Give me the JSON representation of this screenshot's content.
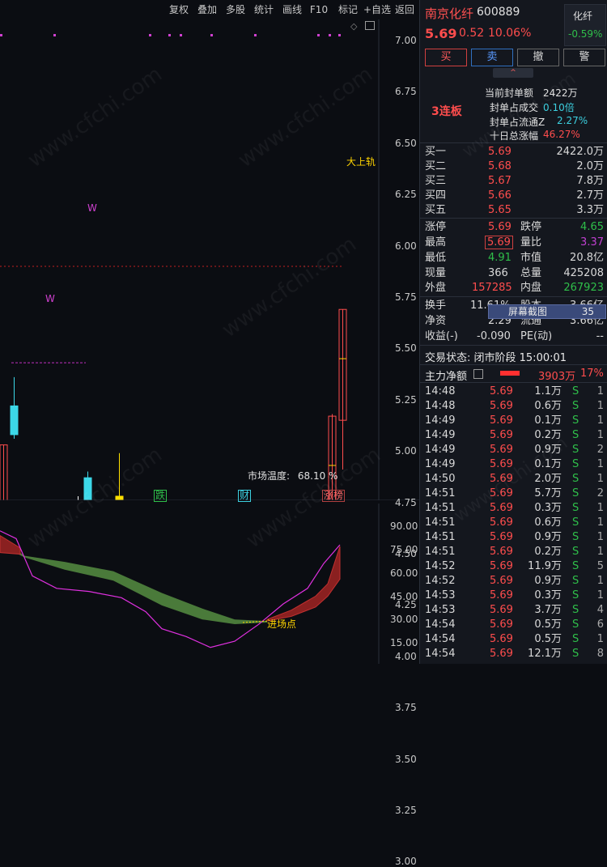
{
  "toolbar": [
    "复权",
    "叠加",
    "多股",
    "统计",
    "画线",
    "F10",
    "标记",
    "+自选",
    "返回"
  ],
  "price_axis": [
    "7.00",
    "6.75",
    "6.50",
    "6.25",
    "6.00",
    "5.75",
    "5.50",
    "5.25",
    "5.00",
    "4.75",
    "4.50",
    "4.25",
    "4.00",
    "3.75",
    "3.50",
    "3.25",
    "3.00"
  ],
  "indicator_axis": [
    "90.00",
    "75.00",
    "60.00",
    "45.00",
    "30.00",
    "15.00"
  ],
  "chart_labels": {
    "upper_band": "大上轨",
    "w_marker_top": "W",
    "w_marker_left": "W",
    "market_temp_label": "市场温度:",
    "market_temp_value": "68.10 %",
    "tag_die": "跌",
    "tag_cai": "财",
    "tag_zhangbang": "涨榜",
    "entry_point": "进场点"
  },
  "stock": {
    "name": "南京化纤",
    "code": "600889",
    "price": "5.69",
    "change": "0.52",
    "change_pct": "10.06%",
    "sector": "化纤",
    "sector_pct": "-0.59%"
  },
  "order_buttons": [
    "买",
    "卖",
    "撤",
    "警"
  ],
  "limit_info": {
    "badge": "3连板",
    "seal_amount_label": "当前封单额",
    "seal_amount": "2422万",
    "seal_deal_label": "封单占成交",
    "seal_deal": "0.10倍",
    "seal_float_label": "封单占流通Z",
    "seal_float": "2.27%",
    "ten_day_label": "十日总涨幅",
    "ten_day": "46.27%"
  },
  "bids": [
    {
      "label": "买一",
      "price": "5.69",
      "vol": "2422.0万"
    },
    {
      "label": "买二",
      "price": "5.68",
      "vol": "2.0万"
    },
    {
      "label": "买三",
      "price": "5.67",
      "vol": "7.8万"
    },
    {
      "label": "买四",
      "price": "5.66",
      "vol": "2.7万"
    },
    {
      "label": "买五",
      "price": "5.65",
      "vol": "3.3万"
    }
  ],
  "stats": {
    "zt_label": "涨停",
    "zt": "5.69",
    "dt_label": "跌停",
    "dt": "4.65",
    "high_label": "最高",
    "high": "5.69",
    "lb_label": "量比",
    "lb": "3.37",
    "low_label": "最低",
    "low": "4.91",
    "mv_label": "市值",
    "mv": "20.8亿",
    "cur_label": "现量",
    "cur": "366",
    "total_label": "总量",
    "total": "425208",
    "outer_label": "外盘",
    "outer": "157285",
    "inner_label": "内盘",
    "inner": "267923",
    "hs_label": "换手",
    "hs": "11.61%",
    "gb_label": "股本",
    "gb": "3.66亿",
    "jz_label": "净资",
    "jz": "2.29",
    "lt_label": "流通",
    "lt": "3.66亿",
    "sy_label": "收益(-)",
    "sy": "-0.090",
    "pe_label": "PE(动)",
    "pe": "--"
  },
  "screenshot_tag": {
    "label": "屏幕截图",
    "value": "35"
  },
  "trade_status": "交易状态: 闭市阶段 15:00:01",
  "main_flow": {
    "label": "主力净额",
    "value": "3903万",
    "pct": "17%"
  },
  "ticks": [
    {
      "time": "14:48",
      "price": "5.69",
      "vol": "1.1万",
      "side": "S",
      "n": "1"
    },
    {
      "time": "14:48",
      "price": "5.69",
      "vol": "0.6万",
      "side": "S",
      "n": "1"
    },
    {
      "time": "14:49",
      "price": "5.69",
      "vol": "0.1万",
      "side": "S",
      "n": "1"
    },
    {
      "time": "14:49",
      "price": "5.69",
      "vol": "0.2万",
      "side": "S",
      "n": "1"
    },
    {
      "time": "14:49",
      "price": "5.69",
      "vol": "0.9万",
      "side": "S",
      "n": "2"
    },
    {
      "time": "14:49",
      "price": "5.69",
      "vol": "0.1万",
      "side": "S",
      "n": "1"
    },
    {
      "time": "14:50",
      "price": "5.69",
      "vol": "2.0万",
      "side": "S",
      "n": "1"
    },
    {
      "time": "14:51",
      "price": "5.69",
      "vol": "5.7万",
      "side": "S",
      "n": "2"
    },
    {
      "time": "14:51",
      "price": "5.69",
      "vol": "0.3万",
      "side": "S",
      "n": "1"
    },
    {
      "time": "14:51",
      "price": "5.69",
      "vol": "0.6万",
      "side": "S",
      "n": "1"
    },
    {
      "time": "14:51",
      "price": "5.69",
      "vol": "0.9万",
      "side": "S",
      "n": "1"
    },
    {
      "time": "14:51",
      "price": "5.69",
      "vol": "0.2万",
      "side": "S",
      "n": "1"
    },
    {
      "time": "14:52",
      "price": "5.69",
      "vol": "11.9万",
      "side": "S",
      "n": "5"
    },
    {
      "time": "14:52",
      "price": "5.69",
      "vol": "0.9万",
      "side": "S",
      "n": "1"
    },
    {
      "time": "14:53",
      "price": "5.69",
      "vol": "0.3万",
      "side": "S",
      "n": "1"
    },
    {
      "time": "14:53",
      "price": "5.69",
      "vol": "3.7万",
      "side": "S",
      "n": "4"
    },
    {
      "time": "14:54",
      "price": "5.69",
      "vol": "0.5万",
      "side": "S",
      "n": "6"
    },
    {
      "time": "14:54",
      "price": "5.69",
      "vol": "0.5万",
      "side": "S",
      "n": "1"
    },
    {
      "time": "14:54",
      "price": "5.69",
      "vol": "12.1万",
      "side": "S",
      "n": "8"
    }
  ],
  "colors": {
    "up": "#ff4d4d",
    "down": "#3cd8e8",
    "flat": "#ffffff",
    "limit": "#ffe000"
  }
}
